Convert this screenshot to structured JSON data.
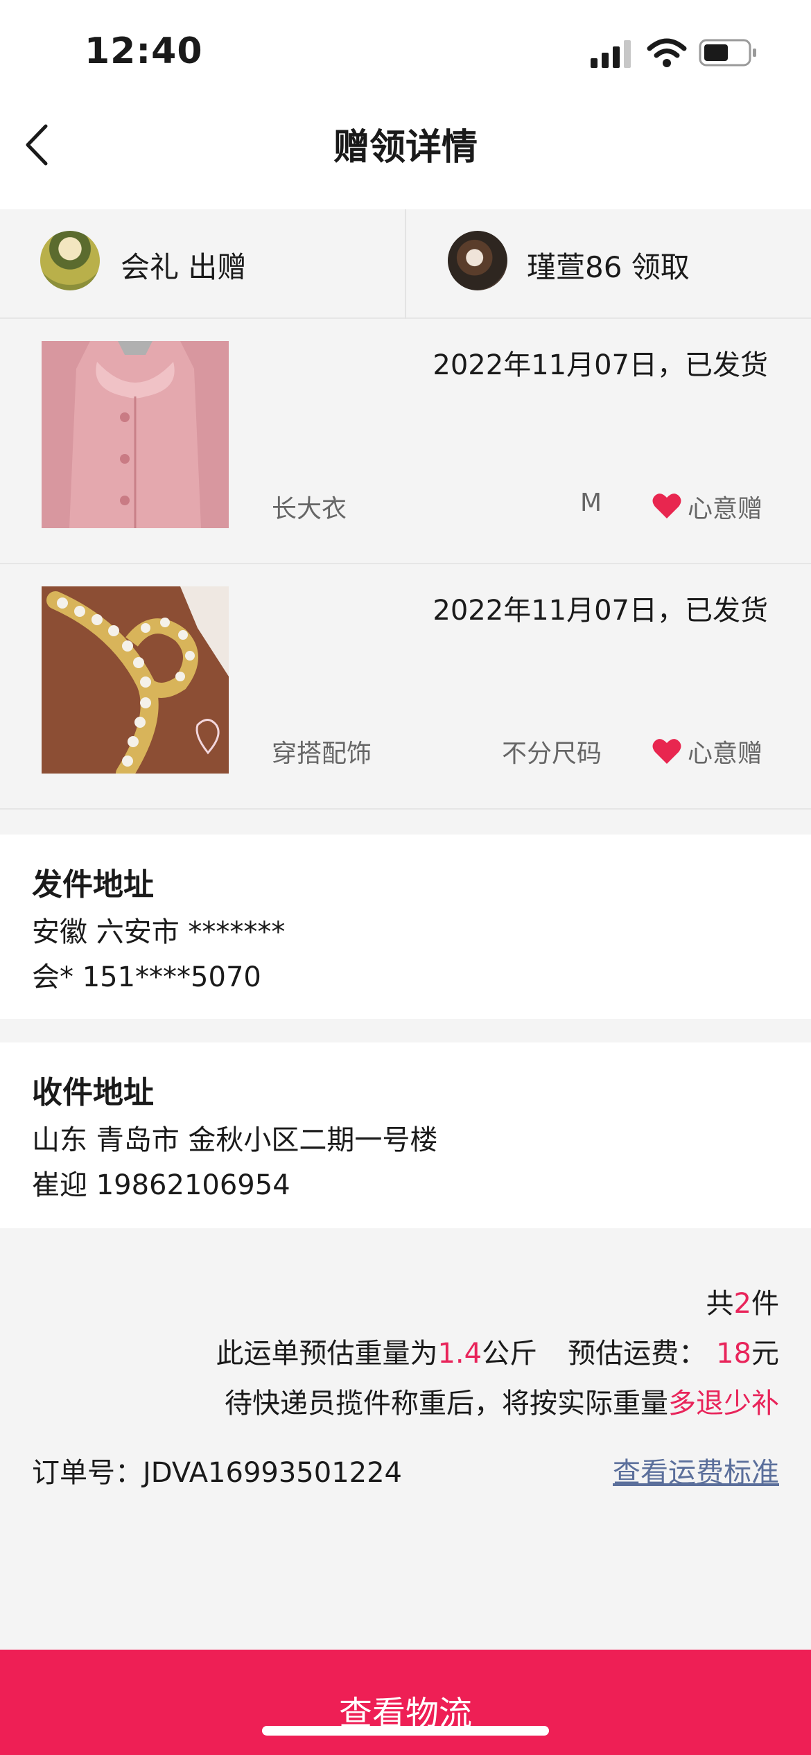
{
  "status_bar": {
    "time": "12:40"
  },
  "nav": {
    "title": "赠领详情"
  },
  "people": {
    "giver_label": "会礼 出赠",
    "receiver_label": "瑾萱86 领取"
  },
  "items": [
    {
      "date_status": "2022年11月07日，已发货",
      "category": "长大衣",
      "size": "M",
      "tag": "心意赠"
    },
    {
      "date_status": "2022年11月07日，已发货",
      "category": "穿搭配饰",
      "size": "不分尺码",
      "tag": "心意赠"
    }
  ],
  "sender": {
    "title": "发件地址",
    "address": "安徽 六安市 *******",
    "contact": "会* 151****5070"
  },
  "receiver": {
    "title": "收件地址",
    "address": "山东 青岛市 金秋小区二期一号楼",
    "contact": "崔迎 19862106954"
  },
  "summary": {
    "total_prefix": "共",
    "total_count": "2",
    "total_suffix": "件",
    "weight_prefix": "此运单预估重量为",
    "weight_value": "1.4",
    "weight_unit": "公斤",
    "fee_prefix": "预估运费：",
    "fee_value": "18",
    "fee_unit": "元",
    "note_prefix": "待快递员揽件称重后，将按实际重量",
    "note_highlight": "多退少补",
    "order_label": "订单号：JDVA16993501224",
    "fee_link": "查看运费标准"
  },
  "bottom_button": {
    "label": "查看物流"
  },
  "colors": {
    "accent": "#ee1f55",
    "highlight": "#e8245a",
    "link": "#5b6f9b",
    "heart": "#e8264f"
  },
  "icons": [
    "back-icon",
    "signal-icon",
    "wifi-icon",
    "battery-icon",
    "heart-icon"
  ]
}
